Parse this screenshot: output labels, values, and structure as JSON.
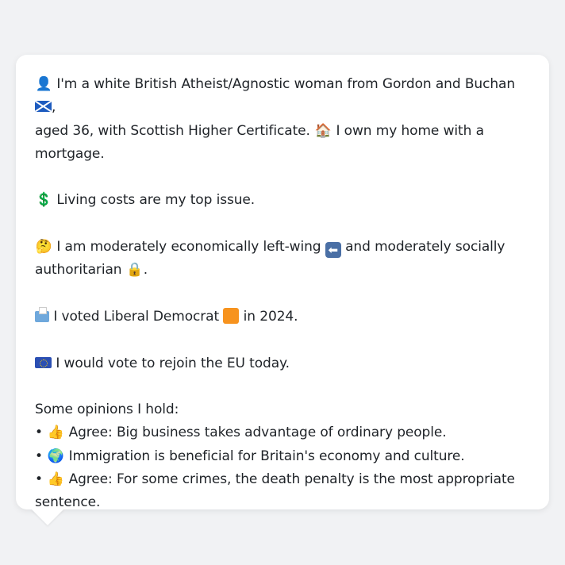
{
  "profile": {
    "line1_a": "I'm a white British Atheist/Agnostic woman from Gordon and Buchan",
    "line1_b": ",",
    "line2_a": "aged 36, with Scottish Higher Certificate.",
    "line2_b": "I own my home with a",
    "line3": "mortgage.",
    "issue": "Living costs are my top issue.",
    "econ_a": "I am moderately economically left-wing",
    "econ_b": "and moderately socially",
    "econ_c": "authoritarian",
    "econ_d": ".",
    "vote_a": "I voted Liberal Democrat",
    "vote_b": "in 2024.",
    "eu": "I would vote to rejoin the EU today.",
    "opinions_heading": "Some opinions I hold:",
    "opinions": [
      {
        "bullet": "•",
        "text": "Agree: Big business takes advantage of ordinary people."
      },
      {
        "bullet": "•",
        "text": "Immigration is beneficial for Britain's economy and culture."
      },
      {
        "bullet": "•",
        "text": "Agree: For some crimes, the death penalty is the most appropriate"
      }
    ],
    "opinion3_cont": "sentence."
  },
  "icons": {
    "person": "👤",
    "house": "🏠",
    "dollar": "💲",
    "thinking": "🤔",
    "left_arrow": "⬅",
    "lock": "🔒",
    "thumbs_up": "👍",
    "globe": "🌍"
  },
  "colors": {
    "background": "#f1f2f4",
    "card": "#ffffff",
    "text": "#1f2328",
    "lib_dem_orange": "#f7931e"
  }
}
